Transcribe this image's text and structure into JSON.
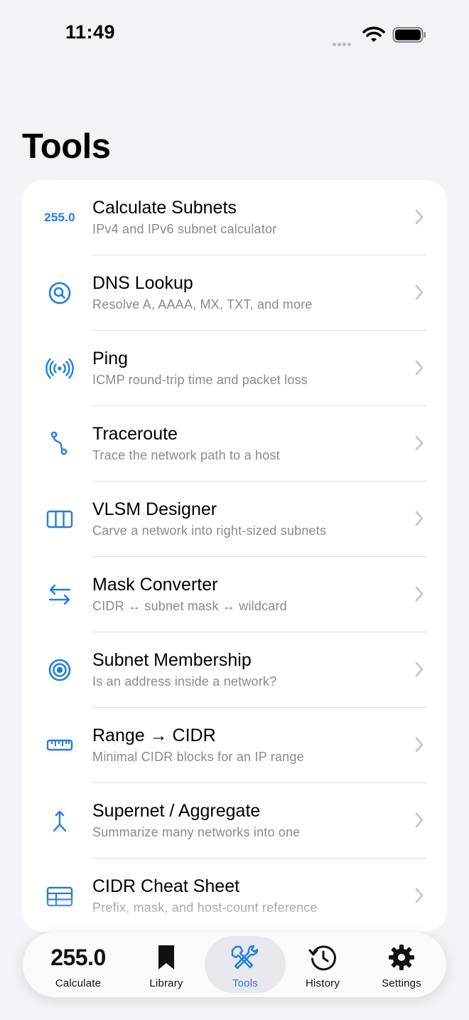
{
  "status_bar": {
    "time": "11:49"
  },
  "page": {
    "title": "Tools"
  },
  "tools": [
    {
      "icon": "subnet-number-icon",
      "icon_text": "255.0",
      "title": "Calculate Subnets",
      "subtitle": "IPv4 and IPv6 subnet calculator"
    },
    {
      "icon": "magnifier-circle-icon",
      "title": "DNS Lookup",
      "subtitle": "Resolve A, AAAA, MX, TXT, and more"
    },
    {
      "icon": "broadcast-waves-icon",
      "title": "Ping",
      "subtitle": "ICMP round-trip time and packet loss"
    },
    {
      "icon": "route-path-icon",
      "title": "Traceroute",
      "subtitle": "Trace the network path to a host"
    },
    {
      "icon": "columns-icon",
      "title": "VLSM Designer",
      "subtitle": "Carve a network into right-sized subnets"
    },
    {
      "icon": "swap-arrows-icon",
      "title": "Mask Converter",
      "subtitle": "CIDR ↔ subnet mask ↔ wildcard"
    },
    {
      "icon": "target-icon",
      "title": "Subnet Membership",
      "subtitle": "Is an address inside a network?"
    },
    {
      "icon": "ruler-icon",
      "title": "Range → CIDR",
      "subtitle": "Minimal CIDR blocks for an IP range"
    },
    {
      "icon": "merge-arrow-icon",
      "title": "Supernet / Aggregate",
      "subtitle": "Summarize many networks into one"
    },
    {
      "icon": "table-icon",
      "title": "CIDR Cheat Sheet",
      "subtitle": "Prefix, mask, and host-count reference"
    }
  ],
  "tab_bar": {
    "active": "Tools",
    "items": [
      {
        "icon_text": "255.0",
        "label": "Calculate"
      },
      {
        "icon": "bookmark-icon",
        "label": "Library"
      },
      {
        "icon": "tools-icon",
        "label": "Tools"
      },
      {
        "icon": "history-clock-icon",
        "label": "History"
      },
      {
        "icon": "gear-icon",
        "label": "Settings"
      }
    ]
  },
  "colors": {
    "accent": "#1f7ce8",
    "background": "#f2f2f7",
    "card": "#ffffff",
    "secondary_text": "#8a8a8e"
  }
}
